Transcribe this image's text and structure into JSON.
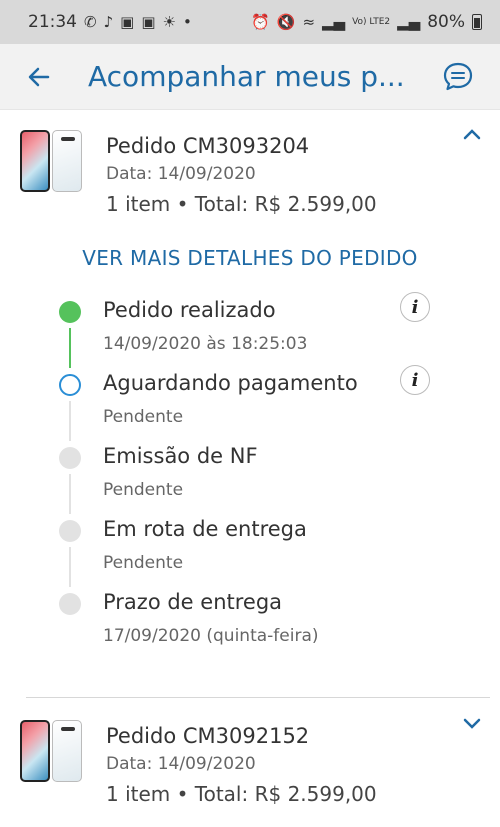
{
  "status_bar": {
    "time": "21:34",
    "battery": "80%",
    "network_label": "Vo) LTE2"
  },
  "app_bar": {
    "title": "Acompanhar meus p...",
    "back_icon": "arrow-left-icon",
    "chat_icon": "chat-bubble-icon"
  },
  "orders": [
    {
      "id": "Pedido CM3093204",
      "date": "Data: 14/09/2020",
      "summary": "1 item • Total: R$ 2.599,00",
      "expanded": true,
      "details_link": "VER MAIS DETALHES DO PEDIDO",
      "timeline": [
        {
          "title": "Pedido realizado",
          "subtitle": "14/09/2020 às 18:25:03",
          "state": "done",
          "info": true
        },
        {
          "title": "Aguardando pagamento",
          "subtitle": "Pendente",
          "state": "current",
          "info": true
        },
        {
          "title": "Emissão de NF",
          "subtitle": "Pendente",
          "state": "pending",
          "info": false
        },
        {
          "title": "Em rota de entrega",
          "subtitle": "Pendente",
          "state": "pending",
          "info": false
        },
        {
          "title": "Prazo de entrega",
          "subtitle": "17/09/2020 (quinta-feira)",
          "state": "pending",
          "info": false
        }
      ]
    },
    {
      "id": "Pedido CM3092152",
      "date": "Data: 14/09/2020",
      "summary": "1 item • Total: R$ 2.599,00",
      "expanded": false
    }
  ],
  "colors": {
    "accent": "#1f6aa5",
    "done": "#55c25c",
    "current": "#2a8ed6",
    "pending": "#e2e2e2"
  },
  "info_glyph": "i"
}
